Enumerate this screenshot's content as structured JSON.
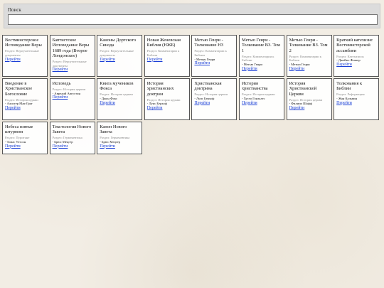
{
  "search": {
    "label": "Поиск",
    "value": "",
    "placeholder": ""
  },
  "cards": [
    {
      "title": "Вестминстерское Исповедание Веры",
      "section": "Раздел: Вероучительные документы",
      "author": "",
      "link": "Перейти"
    },
    {
      "title": "Баптистское Исповедание Веры 1689 года (Второе Лондонское)",
      "section": "Раздел: Вероучительные документы",
      "author": "",
      "link": "Перейти"
    },
    {
      "title": "Каноны Дортского Синода",
      "section": "Раздел: Вероучительные документы",
      "author": "",
      "link": "Перейти"
    },
    {
      "title": "Новая Женевская Библия (НЖБ)",
      "section": "Раздел: Комментарии к Библии",
      "author": "",
      "link": "Перейти"
    },
    {
      "title": "Метью Генри - Толкование НЗ",
      "section": "Раздел: Комментарии к Библии",
      "author": "- Метью Генри",
      "link": "Перейти"
    },
    {
      "title": "Метью Генри - Толкование ВЗ. Том 1",
      "section": "Раздел: Комментарии к Библии",
      "author": "- Метью Генри",
      "link": "Перейти"
    },
    {
      "title": "Метью Генри - Толкование ВЗ. Том 2",
      "section": "Раздел: Комментарии к Библии",
      "author": "- Метью Генри",
      "link": "Перейти"
    },
    {
      "title": "Краткий катехизис Вестминстерской ассамблеи",
      "section": "Раздел: Катехизисы",
      "author": "- Джеймс Фишер",
      "link": "Перейти"
    },
    {
      "title": "Введение в Христианское Богословие",
      "section": "Раздел: История церкви",
      "author": "- Алистер Мак-Грат",
      "link": "Перейти"
    },
    {
      "title": "Исповедь",
      "section": "Раздел: История церкви",
      "author": "- Аврелий Августин",
      "link": "Перейти"
    },
    {
      "title": "Книга мучеников Фокса",
      "section": "Раздел: История церкви",
      "author": "- Джон Фокс",
      "link": "Перейти"
    },
    {
      "title": "История христианских доктрин",
      "section": "Раздел: История церкви",
      "author": "- Луис Берхоф",
      "link": "Перейти"
    },
    {
      "title": "Христианская доктрина",
      "section": "Раздел: История церкви",
      "author": "- Луис Берхоф",
      "link": "Перейти"
    },
    {
      "title": "История христианства",
      "section": "Раздел: История церкви",
      "author": "- Хусто Гонзалес",
      "link": "Перейти"
    },
    {
      "title": "История Христианской Церкви",
      "section": "Раздел: История церкви",
      "author": "- Филипп Шафф",
      "link": "Перейти"
    },
    {
      "title": "Толкования к Библии",
      "section": "Раздел: Реформация",
      "author": "- Жан Кальвин",
      "link": "Перейти"
    },
    {
      "title": "Небеса взятые штурмом",
      "section": "Раздел: Пуритане",
      "author": "- Томас Уотсон",
      "link": "Перейти"
    },
    {
      "title": "Текстология Нового Завета",
      "section": "Раздел: Герменевтика",
      "author": "- Брюс Мецгер",
      "link": "Перейти"
    },
    {
      "title": "Канон Нового Завета",
      "section": "Раздел: Герменевтика",
      "author": "- Брюс Мецгер",
      "link": "Перейти"
    }
  ]
}
